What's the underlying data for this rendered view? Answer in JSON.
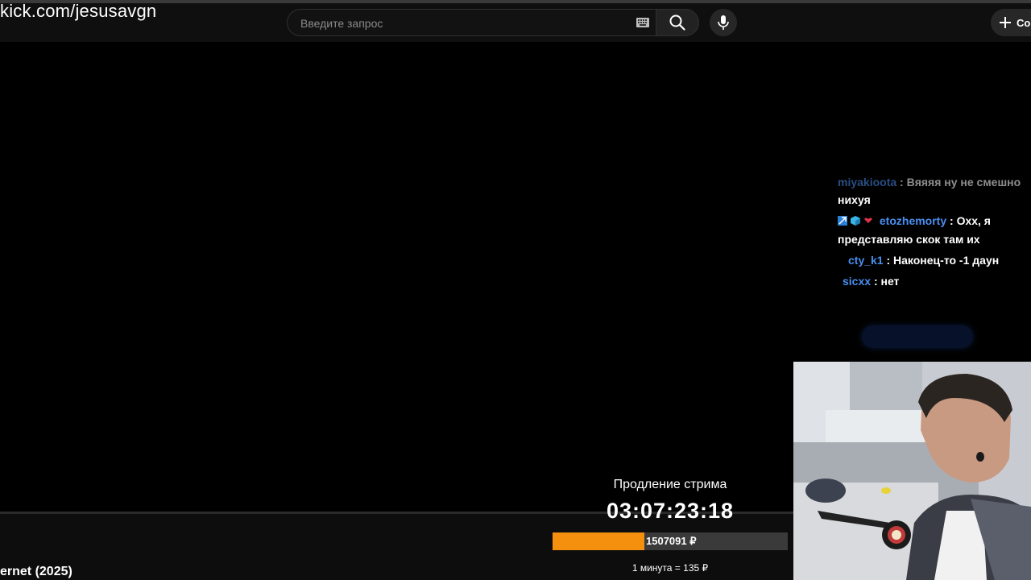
{
  "overlay": {
    "url": "kick.com/jesusavgn"
  },
  "header": {
    "search": {
      "placeholder": "Введите запрос",
      "value": ""
    },
    "create_label": "Со"
  },
  "chat": {
    "messages": [
      {
        "user": "miyakioota",
        "text": "Вяяяя ну не смешно",
        "faded": true
      },
      {
        "user": "",
        "text": "нихуя"
      },
      {
        "user": "etozhemorty",
        "text": ": Охх, я",
        "badges": [
          "prime-badge",
          "cube-badge",
          "heart-badge"
        ]
      },
      {
        "user": "",
        "text": "представляю скок там их"
      },
      {
        "user": "cty_k1",
        "text": ": Наконец-то -1 даун"
      },
      {
        "user": "sicxx",
        "text": ": нет"
      }
    ]
  },
  "subathon": {
    "title": "Продление стрима",
    "timer": "03:07:23:18",
    "amount": "1507091 ₽",
    "progress": 0.39,
    "rate": "1 минута = 135 ₽"
  },
  "video": {
    "title": "ernet (2025)"
  },
  "colors": {
    "accent": "#f5900f",
    "username": "#4a8ff0",
    "bg": "#000000"
  }
}
